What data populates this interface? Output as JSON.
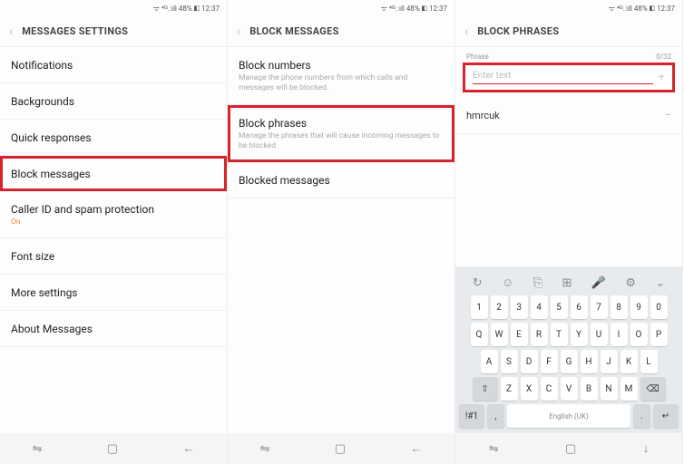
{
  "status": {
    "signal": "ᯤ ⁴ᴳ.⫶ıll 48% ◧ 12:37"
  },
  "screen1": {
    "title": "MESSAGES SETTINGS",
    "items": [
      {
        "label": "Notifications"
      },
      {
        "label": "Backgrounds"
      },
      {
        "label": "Quick responses"
      },
      {
        "label": "Block messages"
      },
      {
        "label": "Caller ID and spam protection",
        "on": "On"
      },
      {
        "label": "Font size"
      },
      {
        "label": "More settings"
      },
      {
        "label": "About Messages"
      }
    ]
  },
  "screen2": {
    "title": "BLOCK MESSAGES",
    "items": [
      {
        "label": "Block numbers",
        "sub": "Manage the phone numbers from which calls and messages will be blocked."
      },
      {
        "label": "Block phrases",
        "sub": "Manage the phrases that will cause incoming messages to be blocked."
      },
      {
        "label": "Blocked messages"
      }
    ]
  },
  "screen3": {
    "title": "BLOCK PHRASES",
    "phraseLabel": "Phrase",
    "counter": "0/32",
    "placeholder": "Enter text",
    "entries": [
      {
        "text": "hmrcuk"
      }
    ]
  },
  "keyboard": {
    "tools": [
      "↻",
      "☺",
      "⎘",
      "⊞",
      "🎤",
      "⚙",
      "⌄"
    ],
    "row1": [
      "1",
      "2",
      "3",
      "4",
      "5",
      "6",
      "7",
      "8",
      "9",
      "0"
    ],
    "row2": [
      "Q",
      "W",
      "E",
      "R",
      "T",
      "Y",
      "U",
      "I",
      "O",
      "P"
    ],
    "row3": [
      "A",
      "S",
      "D",
      "F",
      "G",
      "H",
      "J",
      "K",
      "L"
    ],
    "row4": {
      "shift": "⇧",
      "keys": [
        "Z",
        "X",
        "C",
        "V",
        "B",
        "N",
        "M"
      ],
      "back": "⌫"
    },
    "row5": {
      "sym": "!#1",
      "comma": ",",
      "space": "English (UK)",
      "dot": ".",
      "enter": "↵"
    }
  },
  "nav": {
    "recent": "⇋",
    "home": "▢",
    "back": "←",
    "down": "↓"
  }
}
